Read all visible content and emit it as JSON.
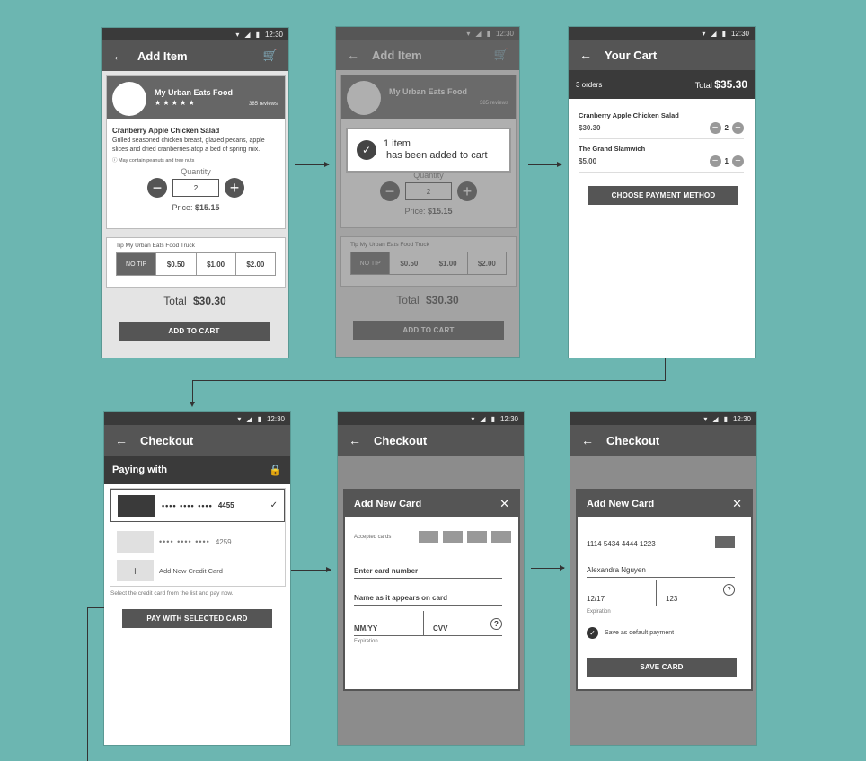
{
  "status": {
    "time": "12:30"
  },
  "screen1": {
    "title": "Add Item",
    "restaurant": "My Urban Eats Food",
    "stars": "★ ★ ★ ★ ★",
    "reviews": "385 reviews",
    "item_name": "Cranberry Apple Chicken Salad",
    "item_desc": "Grilled seasoned chicken breast, glazed pecans, apple slices and dried cranberries atop a bed of spring mix.",
    "allergy_note": "May contain peanuts and tree nuts",
    "quantity_label": "Quantity",
    "quantity_value": "2",
    "price_label": "Price:",
    "price_value": "$15.15",
    "tip_label": "Tip My Urban Eats Food Truck",
    "tips": [
      "NO TIP",
      "$0.50",
      "$1.00",
      "$2.00"
    ],
    "total_label": "Total",
    "total_value": "$30.30",
    "add_to_cart": "ADD TO CART"
  },
  "screen2": {
    "toast_line1": "1 item",
    "toast_line2": "has been added to cart"
  },
  "screen3": {
    "title": "Your Cart",
    "orders": "3 orders",
    "total_label": "Total",
    "total_value": "$35.30",
    "items": [
      {
        "name": "Cranberry Apple Chicken Salad",
        "price": "$30.30",
        "qty": "2"
      },
      {
        "name": "The Grand Slamwich",
        "price": "$5.00",
        "qty": "1"
      }
    ],
    "choose_payment": "CHOOSE PAYMENT METHOD"
  },
  "screen4": {
    "title": "Checkout",
    "paying_with": "Paying with",
    "card1_dots": "•••• •••• ••••",
    "card1_last4": "4455",
    "card2_dots": "•••• •••• ••••",
    "card2_last4": "4259",
    "add_card": "Add New Credit Card",
    "hint": "Select the credit card from the list and pay now.",
    "pay_button": "PAY WITH SELECTED CARD"
  },
  "screen5": {
    "dialog_title": "Add New Card",
    "accepted_cards": "Accepted cards",
    "card_number_placeholder": "Enter card number",
    "name_placeholder": "Name as it appears on card",
    "expiry_placeholder": "MM/YY",
    "cvv_placeholder": "CVV",
    "expiration_label": "Expiration"
  },
  "screen6": {
    "card_number": "1114  5434  4444  1223",
    "name": "Alexandra  Nguyen",
    "expiry": "12/17",
    "cvv": "123",
    "expiration_label": "Expiration",
    "save_default": "Save as default payment",
    "save_card": "SAVE CARD"
  },
  "colors": {
    "background": "#6cb6b1",
    "bar": "#555555",
    "dark": "#3a3a3a"
  }
}
